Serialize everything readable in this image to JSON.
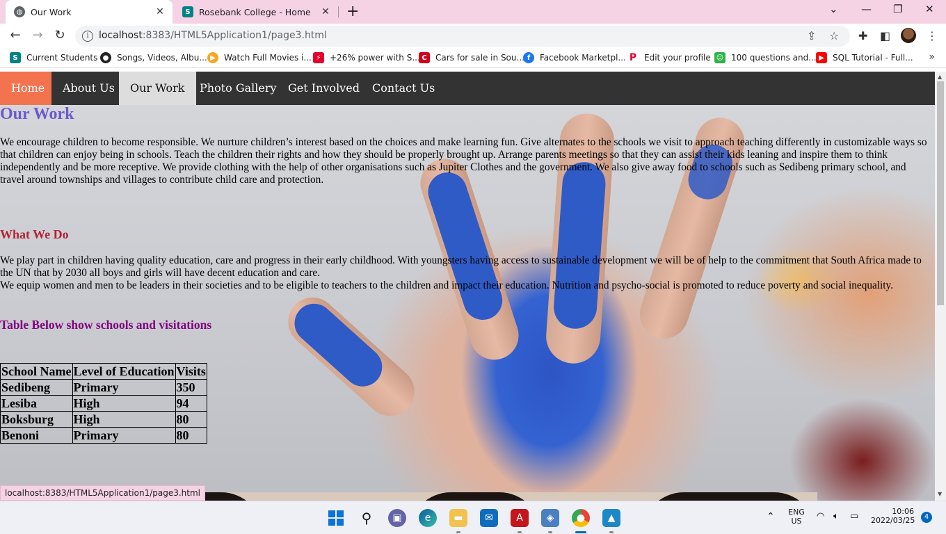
{
  "browser": {
    "tabs": [
      {
        "title": "Our Work",
        "active": true
      },
      {
        "title": "Rosebank College - Home",
        "active": false
      }
    ],
    "url_host": "localhost",
    "url_rest": ":8383/HTML5Application1/page3.html",
    "bookmarks": [
      {
        "label": "Current Students",
        "icon": "sharepoint-icon",
        "color": "#038387"
      },
      {
        "label": "Songs, Videos, Albu...",
        "icon": "music-site-icon",
        "color": "#222222"
      },
      {
        "label": "Watch Full Movies i...",
        "icon": "play-icon",
        "color": "#f5a623"
      },
      {
        "label": "+26% power with S...",
        "icon": "power-icon",
        "color": "#e4002b"
      },
      {
        "label": "Cars for sale in Sou...",
        "icon": "cars-icon",
        "color": "#d0021b"
      },
      {
        "label": "Facebook Marketpl...",
        "icon": "facebook-icon",
        "color": "#1877f2"
      },
      {
        "label": "Edit your profile",
        "icon": "profile-p-icon",
        "color": "#e4002b"
      },
      {
        "label": "100 questions and...",
        "icon": "questions-icon",
        "color": "#2db34a"
      },
      {
        "label": "SQL Tutorial - Full...",
        "icon": "youtube-icon",
        "color": "#ff0000"
      }
    ],
    "status_url": "localhost:8383/HTML5Application1/page3.html"
  },
  "nav": {
    "items": [
      "Home",
      "About Us",
      "Our Work",
      "Photo Gallery",
      "Get Involved",
      "Contact Us"
    ]
  },
  "page": {
    "heading": "Our Work",
    "intro": "We encourage children to become responsible. We nurture children’s interest based on the choices and make learning fun. Give alternates to the schools we visit to approach teaching differently in customizable ways so that children can enjoy being in schools. Teach the children their rights and how they should be properly brought up. Arrange parents meetings so that they can assist their kids leaning and inspire them to think independently and be more receptive. We provide clothing with the help of other organisations such as Jupiter Clothes and the government. We also give away food to schools such as Sedibeng primary school, and travel around townships and villages to contribute child care and protection.",
    "what_heading": "What We Do",
    "what_p1": "We play part in children having quality education, care and progress in their early childhood. With youngsters having access to sustainable development we will be of help to the commitment that South Africa made to the UN that by 2030 all boys and girls will have decent education and care.",
    "what_p2": "We equip women and men to be leaders in their societies and to be eligible to teachers to the children and impact their education. Nutrition and psycho-social is promoted to reduce poverty and social inequality.",
    "table_heading": "Table Below show schools and visitations",
    "table": {
      "headers": [
        "School Name",
        "Level of Education",
        "Visits"
      ],
      "rows": [
        [
          "Sedibeng",
          "Primary",
          "350"
        ],
        [
          "Lesiba",
          "High",
          "94"
        ],
        [
          "Boksburg",
          "High",
          "80"
        ],
        [
          "Benoni",
          "Primary",
          "80"
        ]
      ]
    }
  },
  "taskbar": {
    "lang1": "ENG",
    "lang2": "US",
    "time": "10:06",
    "date": "2022/03/25",
    "notifications": "4"
  },
  "colors": {
    "nav_bg": "#333333",
    "home_bg": "#f4734f",
    "heading": "#6a5acd",
    "what_heading": "#b22234",
    "table_heading": "#800080"
  }
}
